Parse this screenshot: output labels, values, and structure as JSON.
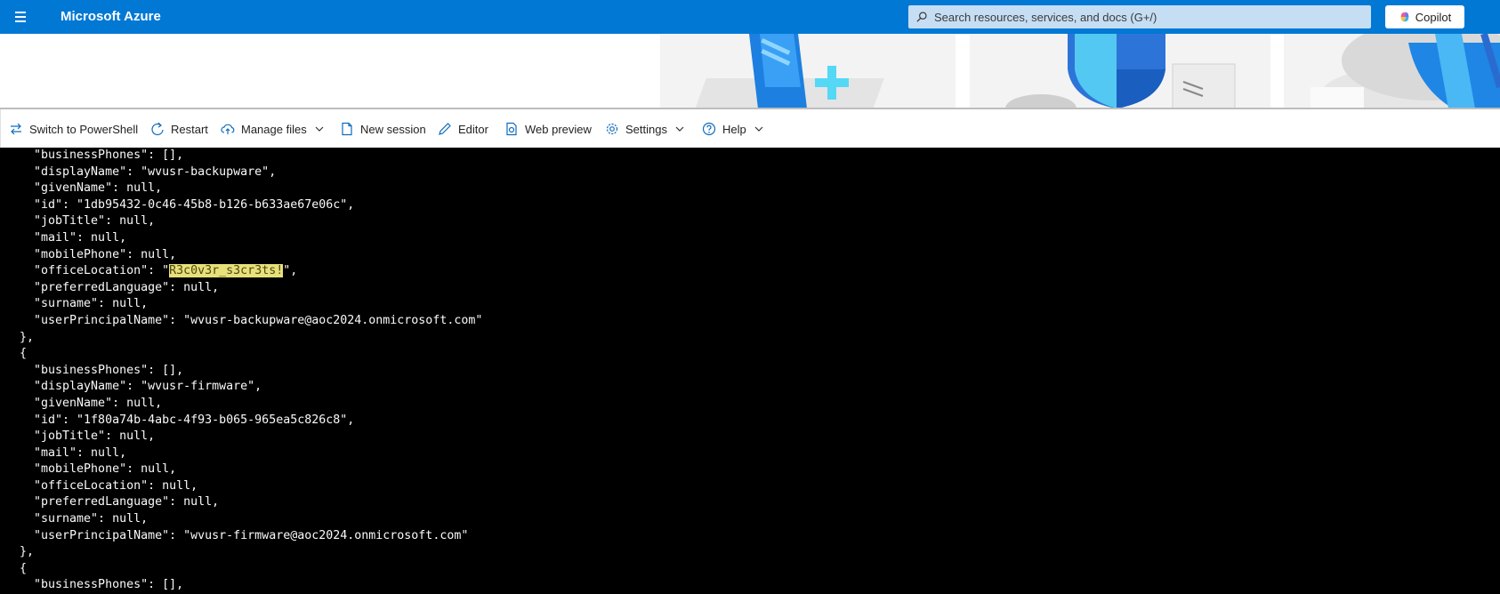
{
  "topbar": {
    "brand": "Microsoft Azure",
    "search_placeholder": "Search resources, services, and docs (G+/)",
    "copilot_label": "Copilot",
    "accent": "#0078d4"
  },
  "toolbar": {
    "switch_shell": "Switch to PowerShell",
    "restart": "Restart",
    "manage_files": "Manage files",
    "new_session": "New session",
    "editor": "Editor",
    "web_preview": "Web preview",
    "settings": "Settings",
    "help": "Help"
  },
  "terminal": {
    "lines": [
      {
        "pre": "  \"businessPhones\": [],"
      },
      {
        "pre": "  \"displayName\": \"wvusr-backupware\","
      },
      {
        "pre": "  \"givenName\": null,"
      },
      {
        "pre": "  \"id\": \"1db95432-0c46-45b8-b126-b633ae67e06c\","
      },
      {
        "pre": "  \"jobTitle\": null,"
      },
      {
        "pre": "  \"mail\": null,"
      },
      {
        "pre": "  \"mobilePhone\": null,"
      },
      {
        "pre": "  \"officeLocation\": \"",
        "hl": "R3c0v3r_s3cr3ts!",
        "post": "\","
      },
      {
        "pre": "  \"preferredLanguage\": null,"
      },
      {
        "pre": "  \"surname\": null,"
      },
      {
        "pre": "  \"userPrincipalName\": \"wvusr-backupware@aoc2024.onmicrosoft.com\""
      },
      {
        "pre": "},"
      },
      {
        "pre": "{"
      },
      {
        "pre": "  \"businessPhones\": [],"
      },
      {
        "pre": "  \"displayName\": \"wvusr-firmware\","
      },
      {
        "pre": "  \"givenName\": null,"
      },
      {
        "pre": "  \"id\": \"1f80a74b-4abc-4f93-b065-965ea5c826c8\","
      },
      {
        "pre": "  \"jobTitle\": null,"
      },
      {
        "pre": "  \"mail\": null,"
      },
      {
        "pre": "  \"mobilePhone\": null,"
      },
      {
        "pre": "  \"officeLocation\": null,"
      },
      {
        "pre": "  \"preferredLanguage\": null,"
      },
      {
        "pre": "  \"surname\": null,"
      },
      {
        "pre": "  \"userPrincipalName\": \"wvusr-firmware@aoc2024.onmicrosoft.com\""
      },
      {
        "pre": "},"
      },
      {
        "pre": "{"
      },
      {
        "pre": "  \"businessPhones\": [],"
      }
    ]
  }
}
